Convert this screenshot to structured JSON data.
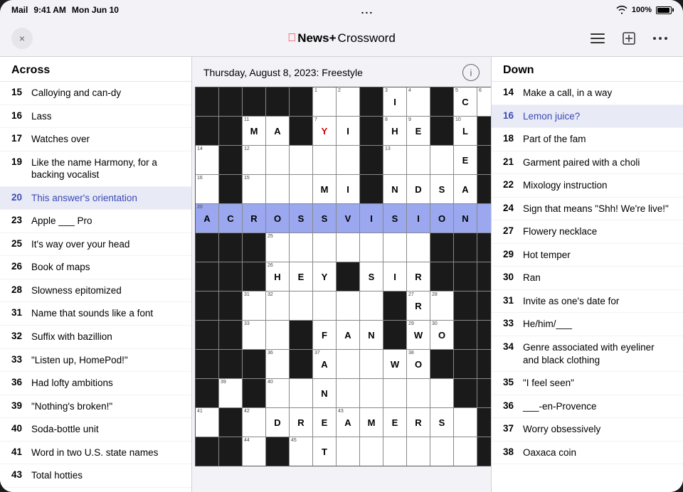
{
  "statusBar": {
    "appName": "Mail",
    "time": "9:41 AM",
    "date": "Mon Jun 10",
    "dots": "...",
    "wifi": "WiFi",
    "battery": "100%"
  },
  "nav": {
    "title": "News+",
    "crosswordLabel": " Crossword",
    "appleLogo": "",
    "closeButton": "×"
  },
  "gridHeader": {
    "title": "Thursday, August 8, 2023: Freestyle",
    "infoSymbol": "i"
  },
  "acrossSection": {
    "header": "Across",
    "clues": [
      {
        "number": "15",
        "text": "Calloying and can-dy"
      },
      {
        "number": "16",
        "text": "Lass"
      },
      {
        "number": "17",
        "text": "Watches over"
      },
      {
        "number": "19",
        "text": "Like the name Harmony, for a backing vocalist"
      },
      {
        "number": "20",
        "text": "This answer's orientation",
        "active": true
      },
      {
        "number": "23",
        "text": "Apple ___ Pro"
      },
      {
        "number": "25",
        "text": "It's way over your head"
      },
      {
        "number": "26",
        "text": "Book of maps"
      },
      {
        "number": "28",
        "text": "Slowness epitomized"
      },
      {
        "number": "31",
        "text": "Name that sounds like a font"
      },
      {
        "number": "32",
        "text": "Suffix with bazillion"
      },
      {
        "number": "33",
        "text": "\"Listen up, HomePod!\""
      },
      {
        "number": "36",
        "text": "Had lofty ambitions"
      },
      {
        "number": "39",
        "text": "\"Nothing's broken!\""
      },
      {
        "number": "40",
        "text": "Soda-bottle unit"
      },
      {
        "number": "41",
        "text": "Word in two U.S. state names"
      },
      {
        "number": "43",
        "text": "Total hotties"
      }
    ]
  },
  "downSection": {
    "header": "Down",
    "clues": [
      {
        "number": "14",
        "text": "Make a call, in a way"
      },
      {
        "number": "16",
        "text": "Lemon juice?",
        "highlighted": true
      },
      {
        "number": "18",
        "text": "Part of the fam"
      },
      {
        "number": "21",
        "text": "Garment paired with a choli"
      },
      {
        "number": "22",
        "text": "Mixology instruction"
      },
      {
        "number": "24",
        "text": "Sign that means \"Shh! We're live!\""
      },
      {
        "number": "27",
        "text": "Flowery necklace"
      },
      {
        "number": "29",
        "text": "Hot temper"
      },
      {
        "number": "30",
        "text": "Ran"
      },
      {
        "number": "31",
        "text": "Invite as one's date for"
      },
      {
        "number": "33",
        "text": "He/him/___"
      },
      {
        "number": "34",
        "text": "Genre associated with eyeliner and black clothing"
      },
      {
        "number": "35",
        "text": "\"I feel seen\""
      },
      {
        "number": "36",
        "text": "___-en-Provence"
      },
      {
        "number": "37",
        "text": "Worry obsessively"
      },
      {
        "number": "38",
        "text": "Oaxaca coin"
      }
    ]
  },
  "grid": {
    "cells": [
      [
        "black",
        "black",
        "black",
        "black",
        "black",
        "black",
        "black",
        "black",
        "black",
        "black",
        "black",
        "black",
        "black"
      ],
      [
        "black",
        "black",
        "",
        "",
        "black",
        "",
        "",
        "",
        "",
        "",
        "black",
        "",
        "black"
      ],
      [
        "black",
        "",
        "",
        "",
        "",
        "",
        "",
        "",
        "",
        "black",
        "",
        "",
        ""
      ],
      [
        "",
        "black",
        "",
        "",
        "",
        "",
        "",
        "black",
        "",
        "",
        "",
        "",
        "black"
      ],
      [
        "",
        "",
        "",
        "",
        "",
        "",
        "",
        "",
        "",
        "",
        "",
        "",
        ""
      ],
      [
        "black",
        "black",
        "black",
        "",
        "",
        "",
        "",
        "",
        "",
        "",
        "",
        "black",
        "black"
      ],
      [
        "black",
        "black",
        "black",
        "",
        "",
        "",
        "",
        "",
        "",
        "",
        "black",
        "black",
        "black"
      ],
      [
        "",
        "",
        "",
        "",
        "",
        "",
        "",
        "",
        "black",
        "",
        "",
        "black",
        "black"
      ],
      [
        "black",
        "black",
        "",
        "",
        "",
        "",
        "",
        "",
        "black",
        "",
        "",
        "",
        ""
      ],
      [
        "black",
        "black",
        "black",
        "",
        "black",
        "",
        "",
        "",
        "",
        "",
        "",
        "black",
        "black"
      ],
      [
        "black",
        "",
        "black",
        "",
        "",
        "",
        "",
        "",
        "",
        "",
        "",
        "",
        ""
      ],
      [
        "",
        "black",
        "",
        "",
        "",
        "",
        "",
        "",
        "",
        "",
        "",
        "",
        "black"
      ],
      [
        "black",
        "black",
        "",
        "black",
        "",
        "",
        "",
        "",
        "",
        "",
        "",
        "",
        "black"
      ]
    ]
  }
}
